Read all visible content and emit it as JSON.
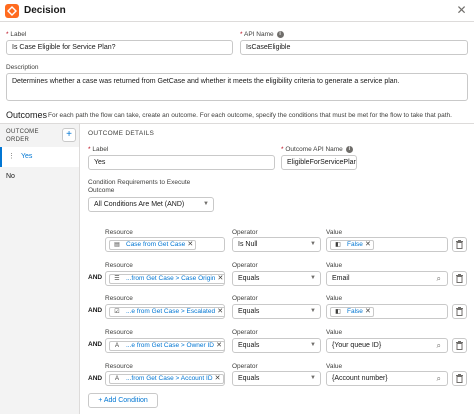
{
  "header": {
    "title": "Decision",
    "icon": "decision-icon",
    "close_icon": "close-icon",
    "accent": "#ff6b1f"
  },
  "form": {
    "label_caption": "Label",
    "label_value": "Is Case Eligible for Service Plan?",
    "api_caption": "API Name",
    "api_value": "IsCaseEligible",
    "description_caption": "Description",
    "description_value": "Determines whether a case was returned from GetCase and whether it meets the eligibility criteria to generate a service plan."
  },
  "outcomes": {
    "title": "Outcomes",
    "description": "For each path the flow can take, create an outcome. For each outcome, specify the conditions that must be met for the flow to take that path.",
    "order_label_1": "OUTCOME",
    "order_label_2": "ORDER",
    "add_label": "+",
    "items": [
      {
        "label": "Yes"
      },
      {
        "label": "No"
      }
    ]
  },
  "details": {
    "title": "OUTCOME DETAILS",
    "label_caption": "Label",
    "label_value": "Yes",
    "api_caption": "Outcome API Name",
    "api_value": "EligibleForServicePlan",
    "cond_caption": "Condition Requirements to Execute",
    "cond_caption2": "Outcome",
    "cond_value": "All Conditions Are Met (AND)",
    "resource_caption": "Resource",
    "operator_caption": "Operator",
    "value_caption": "Value",
    "and_label": "AND",
    "add_condition_label": "+ Add Condition",
    "rows": [
      {
        "resource": "Case from Get Case",
        "resource_icon": "record-icon",
        "operator": "Is Null",
        "value": "False",
        "value_is_pill": true
      },
      {
        "resource": "...from Get Case > Case Origin",
        "resource_icon": "picklist-icon",
        "operator": "Equals",
        "value": "Email",
        "value_is_pill": false
      },
      {
        "resource": "...e from Get Case > Escalated",
        "resource_icon": "checkbox-icon",
        "operator": "Equals",
        "value": "False",
        "value_is_pill": true
      },
      {
        "resource": "...e from Get Case > Owner ID",
        "resource_icon": "text-icon",
        "operator": "Equals",
        "value": "{Your queue ID}",
        "value_is_pill": false
      },
      {
        "resource": "...from Get Case > Account ID",
        "resource_icon": "text-icon",
        "operator": "Equals",
        "value": "{Account number}",
        "value_is_pill": false
      }
    ]
  }
}
